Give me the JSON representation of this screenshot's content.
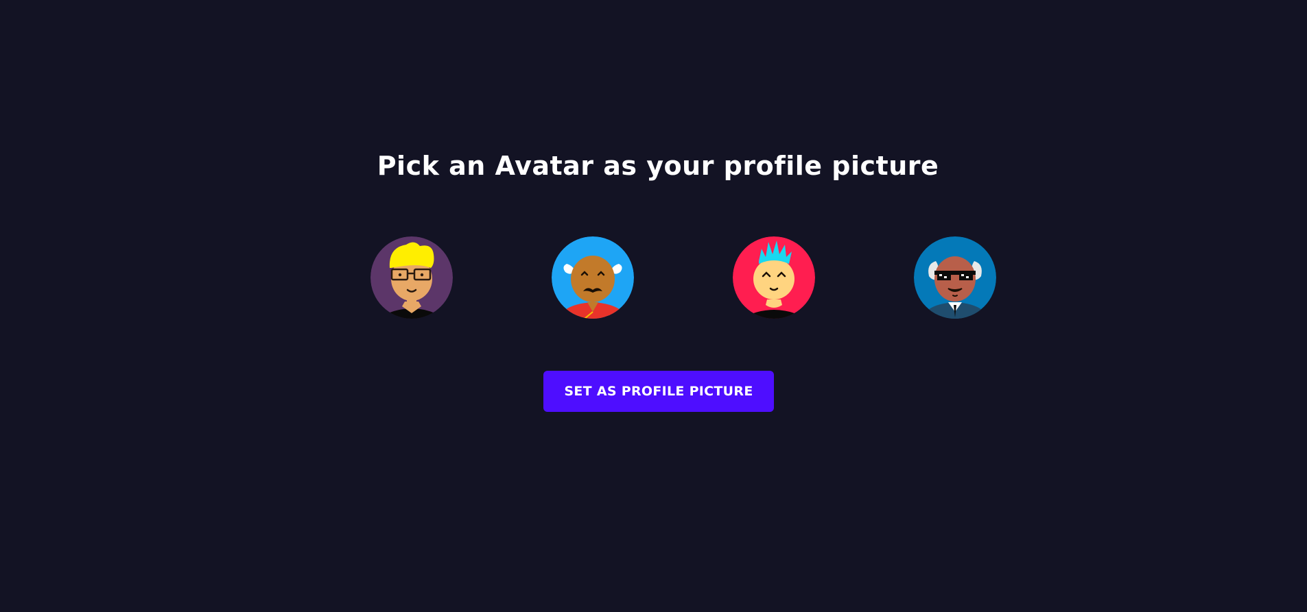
{
  "heading": "Pick an Avatar as your profile picture",
  "avatars": [
    {
      "name": "avatar-blonde-glasses",
      "bg": "#5c3669"
    },
    {
      "name": "avatar-bald-mustache",
      "bg": "#1ea5f5"
    },
    {
      "name": "avatar-cyan-mohawk",
      "bg": "#ff1e50"
    },
    {
      "name": "avatar-sunglasses-elder",
      "bg": "#0479b8"
    }
  ],
  "button_label": "SET AS PROFILE PICTURE",
  "colors": {
    "background": "#131324",
    "accent": "#4e0eff",
    "text": "#ffffff"
  }
}
